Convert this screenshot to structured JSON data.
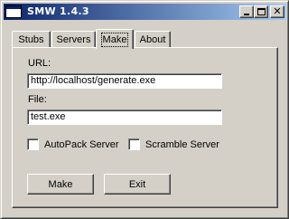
{
  "window": {
    "title": "SMW 1.4.3",
    "icon": "app-window-icon",
    "controls": {
      "minimize": "minimize-icon",
      "maximize": "maximize-icon",
      "close": "close-icon"
    },
    "colors": {
      "titlebar_start": "#0a246a",
      "titlebar_end": "#a6caf0",
      "face": "#d4d0c8"
    }
  },
  "tabs": [
    {
      "label": "Stubs"
    },
    {
      "label": "Servers"
    },
    {
      "label": "Make",
      "selected": true
    },
    {
      "label": "About"
    }
  ],
  "form": {
    "url_label": "URL:",
    "url_value": "http://localhost/generate.exe",
    "file_label": "File:",
    "file_value": "test.exe",
    "autopack_label": "AutoPack Server",
    "autopack_checked": false,
    "scramble_label": "Scramble Server",
    "scramble_checked": false
  },
  "buttons": {
    "make": "Make",
    "exit": "Exit"
  }
}
